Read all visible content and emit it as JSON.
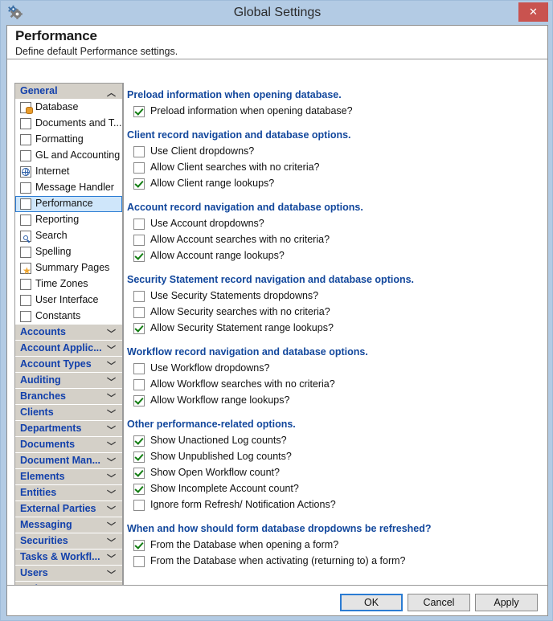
{
  "window": {
    "title": "Global Settings",
    "icon": "gears-icon",
    "close_label": "✕"
  },
  "header": {
    "title": "Performance",
    "subtitle": "Define default Performance settings."
  },
  "sidebar": {
    "groups": [
      {
        "label": "General",
        "expanded": true,
        "chevron": "︿",
        "items": [
          {
            "label": "Database",
            "icon": "database-icon",
            "selected": false
          },
          {
            "label": "Documents and T...",
            "icon": "blank-icon",
            "selected": false
          },
          {
            "label": "Formatting",
            "icon": "blank-icon",
            "selected": false
          },
          {
            "label": "GL and Accounting",
            "icon": "blank-icon",
            "selected": false
          },
          {
            "label": "Internet",
            "icon": "globe-icon",
            "selected": false
          },
          {
            "label": "Message Handler",
            "icon": "blank-icon",
            "selected": false
          },
          {
            "label": "Performance",
            "icon": "blank-icon",
            "selected": true
          },
          {
            "label": "Reporting",
            "icon": "blank-icon",
            "selected": false
          },
          {
            "label": "Search",
            "icon": "search-icon",
            "selected": false
          },
          {
            "label": "Spelling",
            "icon": "blank-icon",
            "selected": false
          },
          {
            "label": "Summary Pages",
            "icon": "star-icon",
            "selected": false
          },
          {
            "label": "Time Zones",
            "icon": "blank-icon",
            "selected": false
          },
          {
            "label": "User Interface",
            "icon": "blank-icon",
            "selected": false
          },
          {
            "label": "Constants",
            "icon": "blank-icon",
            "selected": false
          }
        ]
      },
      {
        "label": "Accounts",
        "expanded": false,
        "chevron": "﹀",
        "items": []
      },
      {
        "label": "Account Applic...",
        "expanded": false,
        "chevron": "﹀",
        "items": []
      },
      {
        "label": "Account Types",
        "expanded": false,
        "chevron": "﹀",
        "items": []
      },
      {
        "label": "Auditing",
        "expanded": false,
        "chevron": "﹀",
        "items": []
      },
      {
        "label": "Branches",
        "expanded": false,
        "chevron": "﹀",
        "items": []
      },
      {
        "label": "Clients",
        "expanded": false,
        "chevron": "﹀",
        "items": []
      },
      {
        "label": "Departments",
        "expanded": false,
        "chevron": "﹀",
        "items": []
      },
      {
        "label": "Documents",
        "expanded": false,
        "chevron": "﹀",
        "items": []
      },
      {
        "label": "Document Man...",
        "expanded": false,
        "chevron": "﹀",
        "items": []
      },
      {
        "label": "Elements",
        "expanded": false,
        "chevron": "﹀",
        "items": []
      },
      {
        "label": "Entities",
        "expanded": false,
        "chevron": "﹀",
        "items": []
      },
      {
        "label": "External Parties",
        "expanded": false,
        "chevron": "﹀",
        "items": []
      },
      {
        "label": "Messaging",
        "expanded": false,
        "chevron": "﹀",
        "items": []
      },
      {
        "label": "Securities",
        "expanded": false,
        "chevron": "﹀",
        "items": []
      },
      {
        "label": "Tasks & Workfl...",
        "expanded": false,
        "chevron": "﹀",
        "items": []
      },
      {
        "label": "Users",
        "expanded": false,
        "chevron": "﹀",
        "items": []
      },
      {
        "label": "Web",
        "expanded": false,
        "chevron": "﹀",
        "items": []
      }
    ]
  },
  "content": {
    "groups": [
      {
        "title": "Preload information when opening database.",
        "options": [
          {
            "label": "Preload information when opening database?",
            "checked": true
          }
        ]
      },
      {
        "title": "Client record navigation and database options.",
        "options": [
          {
            "label": "Use Client dropdowns?",
            "checked": false
          },
          {
            "label": "Allow Client searches with no criteria?",
            "checked": false
          },
          {
            "label": "Allow Client range lookups?",
            "checked": true
          }
        ]
      },
      {
        "title": "Account record navigation and database options.",
        "options": [
          {
            "label": "Use Account dropdowns?",
            "checked": false
          },
          {
            "label": "Allow Account searches with no criteria?",
            "checked": false
          },
          {
            "label": "Allow Account range lookups?",
            "checked": true
          }
        ]
      },
      {
        "title": "Security Statement record navigation and database options.",
        "options": [
          {
            "label": "Use Security Statements dropdowns?",
            "checked": false
          },
          {
            "label": "Allow Security searches with no criteria?",
            "checked": false
          },
          {
            "label": "Allow Security Statement range lookups?",
            "checked": true
          }
        ]
      },
      {
        "title": "Workflow record navigation and database options.",
        "options": [
          {
            "label": "Use Workflow dropdowns?",
            "checked": false
          },
          {
            "label": "Allow Workflow searches with no criteria?",
            "checked": false
          },
          {
            "label": "Allow Workflow range lookups?",
            "checked": true
          }
        ]
      },
      {
        "title": "Other performance-related options.",
        "options": [
          {
            "label": "Show Unactioned Log counts?",
            "checked": true
          },
          {
            "label": "Show Unpublished Log counts?",
            "checked": true
          },
          {
            "label": "Show Open Workflow count?",
            "checked": true
          },
          {
            "label": "Show Incomplete Account count?",
            "checked": true
          },
          {
            "label": "Ignore form Refresh/ Notification Actions?",
            "checked": false
          }
        ]
      },
      {
        "title": "When and how should form database dropdowns be refreshed?",
        "options": [
          {
            "label": "From the Database when opening a form?",
            "checked": true
          },
          {
            "label": "From the Database when activating (returning to) a form?",
            "checked": false
          }
        ]
      }
    ]
  },
  "footer": {
    "ok_label": "OK",
    "cancel_label": "Cancel",
    "apply_label": "Apply"
  },
  "colors": {
    "titlebar": "#b3cbe4",
    "close": "#c9534f",
    "group_heading": "#12479c",
    "category_label": "#1240ab",
    "selection": "#cfe6fa",
    "selection_border": "#2b7cd3",
    "check": "#117d11",
    "category_bg": "#d4d0c8"
  }
}
